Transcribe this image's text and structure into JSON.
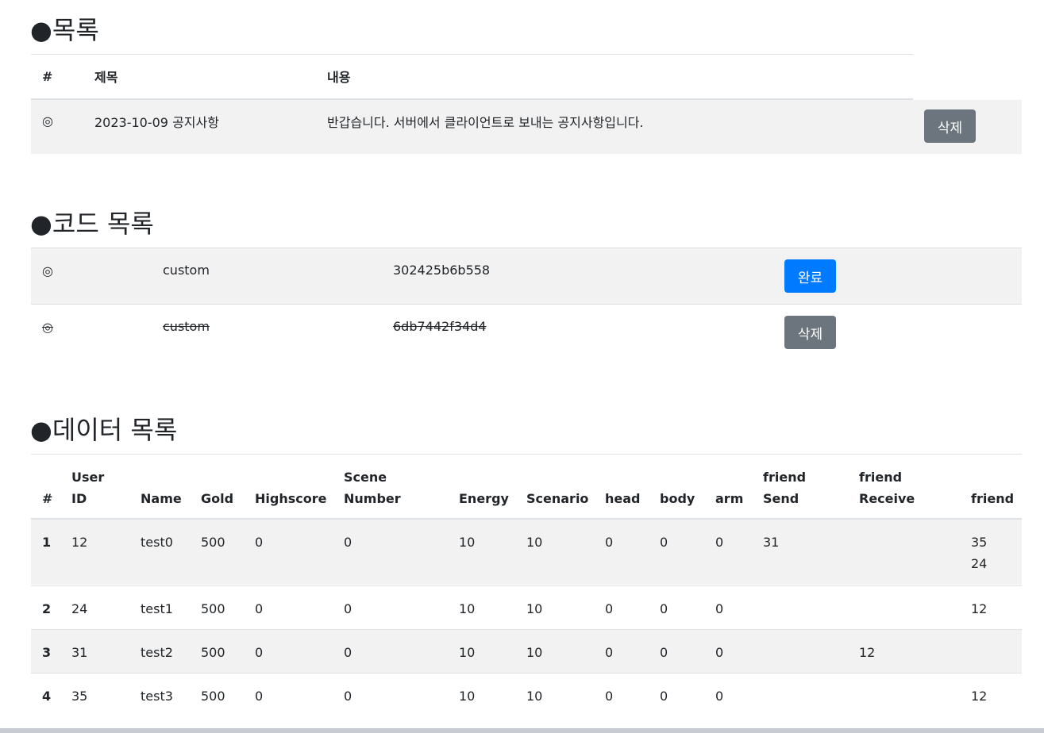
{
  "notice_section": {
    "title": "●목록",
    "headers": [
      "#",
      "제목",
      "내용"
    ],
    "rows": [
      {
        "mark": "◎",
        "title": "2023-10-09 공지사항",
        "content": "반갑습니다. 서버에서 클라이언트로 보내는 공지사항입니다.",
        "button": "삭제"
      }
    ]
  },
  "code_section": {
    "title": "●코드 목록",
    "rows": [
      {
        "mark": "◎",
        "type": "custom",
        "code": "302425b6b558",
        "button": "완료",
        "used": false
      },
      {
        "mark": "◎",
        "type": "custom",
        "code": "6db7442f34d4",
        "button": "삭제",
        "used": true
      }
    ]
  },
  "data_section": {
    "title": "●데이터 목록",
    "headers": [
      {
        "l1": "",
        "l2": "#"
      },
      {
        "l1": "User",
        "l2": "ID"
      },
      {
        "l1": "",
        "l2": "Name"
      },
      {
        "l1": "",
        "l2": "Gold"
      },
      {
        "l1": "",
        "l2": "Highscore"
      },
      {
        "l1": "Scene",
        "l2": "Number"
      },
      {
        "l1": "",
        "l2": "Energy"
      },
      {
        "l1": "",
        "l2": "Scenario"
      },
      {
        "l1": "",
        "l2": "head"
      },
      {
        "l1": "",
        "l2": "body"
      },
      {
        "l1": "",
        "l2": "arm"
      },
      {
        "l1": "friend",
        "l2": "Send"
      },
      {
        "l1": "friend",
        "l2": "Receive"
      },
      {
        "l1": "",
        "l2": "friend"
      }
    ],
    "rows": [
      {
        "num": "1",
        "user_id": "12",
        "name": "test0",
        "gold": "500",
        "highscore": "0",
        "scene_number": "0",
        "energy": "10",
        "scenario": "10",
        "head": "0",
        "body": "0",
        "arm": "0",
        "friend_send": "31",
        "friend_receive": "",
        "friend": [
          "35",
          "24"
        ]
      },
      {
        "num": "2",
        "user_id": "24",
        "name": "test1",
        "gold": "500",
        "highscore": "0",
        "scene_number": "0",
        "energy": "10",
        "scenario": "10",
        "head": "0",
        "body": "0",
        "arm": "0",
        "friend_send": "",
        "friend_receive": "",
        "friend": [
          "12",
          ""
        ]
      },
      {
        "num": "3",
        "user_id": "31",
        "name": "test2",
        "gold": "500",
        "highscore": "0",
        "scene_number": "0",
        "energy": "10",
        "scenario": "10",
        "head": "0",
        "body": "0",
        "arm": "0",
        "friend_send": "",
        "friend_receive": "12",
        "friend": [
          "",
          ""
        ]
      },
      {
        "num": "4",
        "user_id": "35",
        "name": "test3",
        "gold": "500",
        "highscore": "0",
        "scene_number": "0",
        "energy": "10",
        "scenario": "10",
        "head": "0",
        "body": "0",
        "arm": "0",
        "friend_send": "",
        "friend_receive": "",
        "friend": [
          "12",
          ""
        ]
      }
    ]
  }
}
